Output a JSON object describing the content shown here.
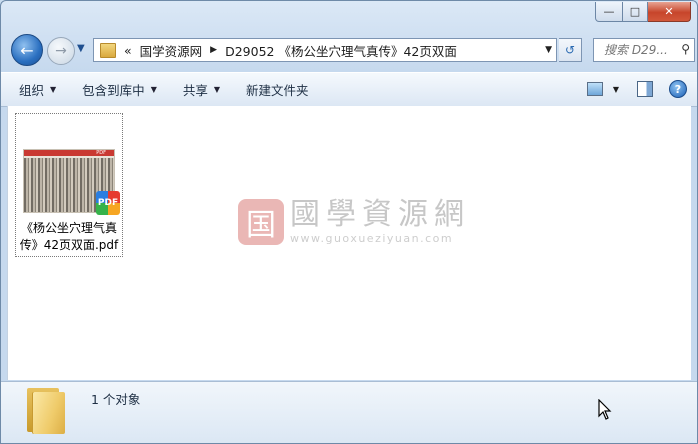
{
  "window": {
    "caption": {
      "minimize": "—",
      "maximize": "□",
      "close": "✕"
    }
  },
  "nav": {
    "back_icon": "back-arrow-icon",
    "forward_icon": "forward-arrow-icon",
    "chevron": "«",
    "breadcrumb": [
      "国学资源网",
      "D29052 《杨公坐穴理气真传》42页双面"
    ],
    "search_placeholder": "搜索 D29..."
  },
  "toolbar": {
    "items": [
      "组织",
      "包含到库中",
      "共享",
      "新建文件夹"
    ]
  },
  "files": [
    {
      "name": "《杨公坐穴理气真传》42页双面.pdf",
      "badge": "PDF",
      "thumb_tag": "PDF"
    }
  ],
  "watermark": {
    "logo_char": "国",
    "title": "國學資源網",
    "url": "www.guoxueziyuan.com"
  },
  "details": {
    "summary": "1 个对象"
  },
  "colors": {
    "close_red": "#c7452b",
    "accent_blue": "#2a6fc0",
    "folder_yellow": "#efcb6a"
  }
}
